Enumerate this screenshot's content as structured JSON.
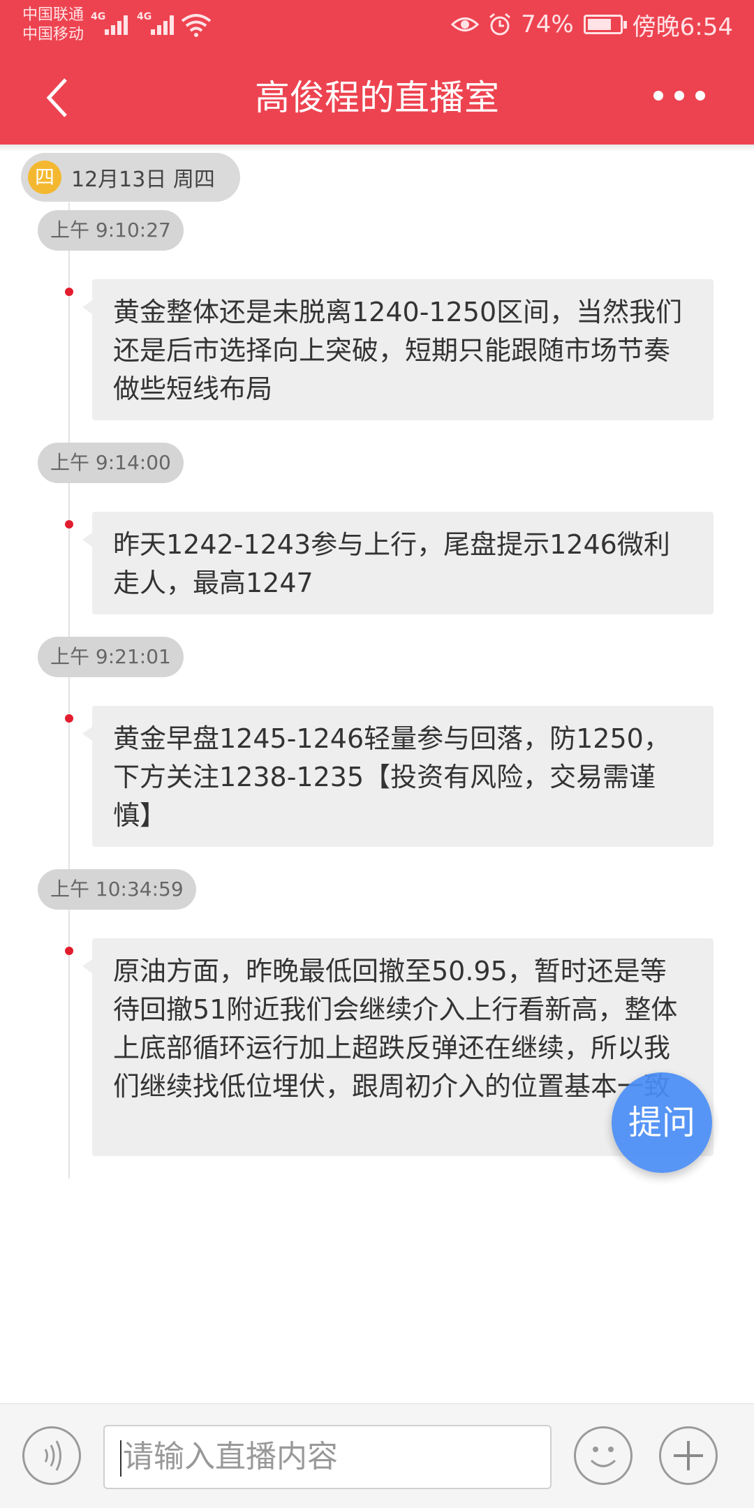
{
  "status_bar": {
    "carrier1": "中国联通",
    "carrier2": "中国移动",
    "network1": "4G",
    "network2": "4G",
    "battery_percent": "74%",
    "battery_level": 0.74,
    "time": "傍晚6:54",
    "icons": [
      "signal-icon",
      "wifi-icon",
      "eye-icon",
      "alarm-icon",
      "battery-icon"
    ]
  },
  "header": {
    "title": "高俊程的直播室",
    "back_icon": "back-arrow-icon",
    "more_icon": "more-dots-icon"
  },
  "date_chip": {
    "weekday_badge": "四",
    "text": "12月13日  周四"
  },
  "messages": [
    {
      "time": "上午 9:10:27",
      "text": "黄金整体还是未脱离1240-1250区间，当然我们还是后市选择向上突破，短期只能跟随市场节奏做些短线布局"
    },
    {
      "time": "上午 9:14:00",
      "text": "昨天1242-1243参与上行，尾盘提示1246微利走人，最高1247"
    },
    {
      "time": "上午 9:21:01",
      "text": "黄金早盘1245-1246轻量参与回落，防1250，下方关注1238-1235【投资有风险，交易需谨慎】"
    },
    {
      "time": "上午 10:34:59",
      "text": "原油方面，昨晚最低回撤至50.95，暂时还是等待回撤51附近我们会继续介入上行看新高，整体上底部循环运行加上超跌反弹还在继续，所以我们继续找低位埋伏，跟周初介入的位置基本一致"
    }
  ],
  "ask_button": "提问",
  "input_bar": {
    "placeholder": "请输入直播内容",
    "voice_icon": "voice-icon",
    "emoji_icon": "emoji-icon",
    "plus_icon": "plus-icon"
  },
  "colors": {
    "header_red": "#ed4350",
    "dot_red": "#e21d2e",
    "ask_blue": "#4a8ef6",
    "date_badge": "#f4b830"
  }
}
